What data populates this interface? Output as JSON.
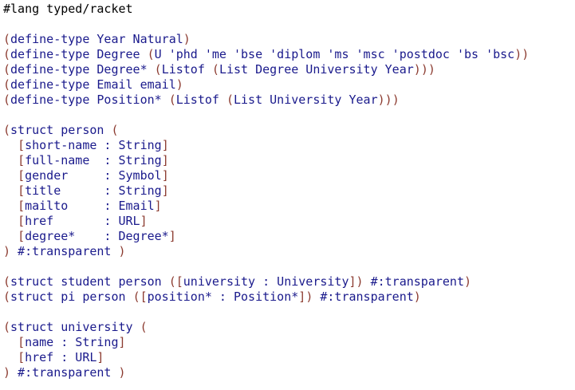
{
  "lines": [
    "#lang typed/racket",
    "",
    "(define-type Year Natural)",
    "(define-type Degree (U 'phd 'me 'bse 'diplom 'ms 'msc 'postdoc 'bs 'bsc))",
    "(define-type Degree* (Listof (List Degree University Year)))",
    "(define-type Email email)",
    "(define-type Position* (Listof (List University Year)))",
    "",
    "(struct person (",
    "  [short-name : String]",
    "  [full-name  : String]",
    "  [gender     : Symbol]",
    "  [title      : String]",
    "  [mailto     : Email]",
    "  [href       : URL]",
    "  [degree*    : Degree*]",
    ") #:transparent )",
    "",
    "(struct student person ([university : University]) #:transparent)",
    "(struct pi person ([position* : Position*]) #:transparent)",
    "",
    "(struct university (",
    "  [name : String]",
    "  [href : URL]",
    ") #:transparent )"
  ]
}
